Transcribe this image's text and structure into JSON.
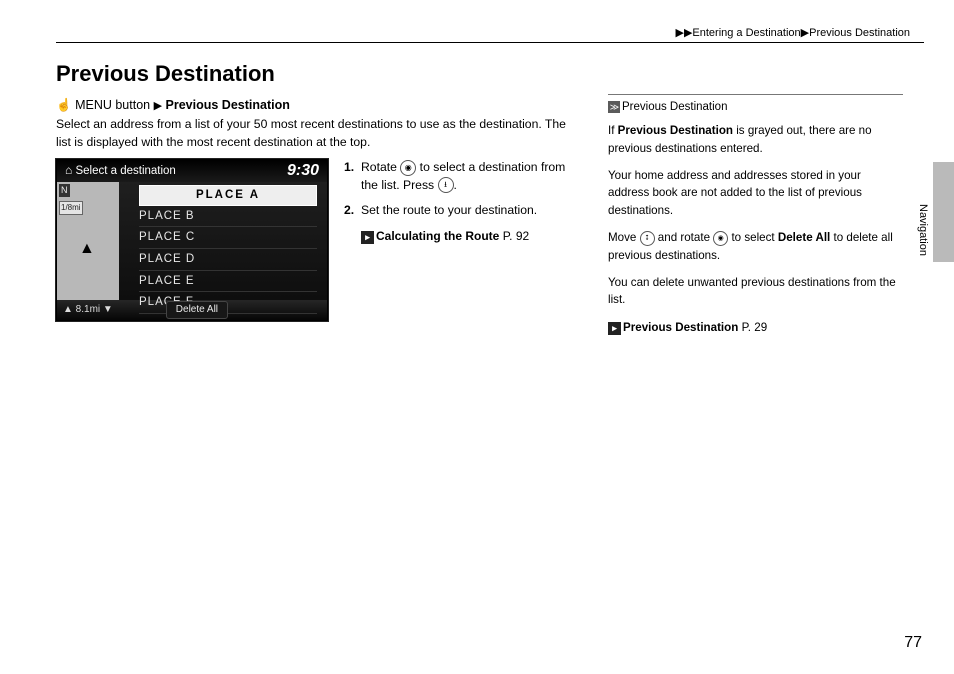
{
  "breadcrumb": {
    "chev": "▶▶",
    "a": "Entering a Destination",
    "sep": "▶",
    "b": "Previous Destination"
  },
  "title": "Previous Destination",
  "path": {
    "icon": "☝",
    "menu": "MENU button",
    "arrow": "▶",
    "dest": "Previous Destination"
  },
  "intro": "Select an address from a list of your 50 most recent destinations to use as the destination. The list is displayed with the most recent destination at the top.",
  "screen": {
    "home_icon": "⌂",
    "header": "Select a destination",
    "clock": "9:30",
    "compass": "N",
    "scale": "1/8mi",
    "items": [
      "PLACE A",
      "PLACE B",
      "PLACE C",
      "PLACE D",
      "PLACE E",
      "PLACE F"
    ],
    "foot_left": "▲   8.1mi ▼",
    "delete": "Delete All"
  },
  "steps": {
    "s1a": "Rotate ",
    "s1b": " to select a destination from the list. Press ",
    "s1c": ".",
    "s2": "Set the route to your destination.",
    "xref_label": "Calculating the Route",
    "xref_page": "P. 92"
  },
  "side": {
    "head": "Previous Destination",
    "p1a": "If ",
    "p1b": "Previous Destination",
    "p1c": " is grayed out, there are no previous destinations entered.",
    "p2": "Your home address and addresses stored in your address book are not added to the list of previous destinations.",
    "p3a": "Move ",
    "p3b": " and rotate ",
    "p3c": " to select ",
    "p3d": "Delete All",
    "p3e": " to delete all previous destinations.",
    "p4": "You can delete unwanted previous destinations from the list.",
    "xref_label": "Previous Destination",
    "xref_page": "P. 29"
  },
  "tab": "Navigation",
  "pagenum": "77"
}
